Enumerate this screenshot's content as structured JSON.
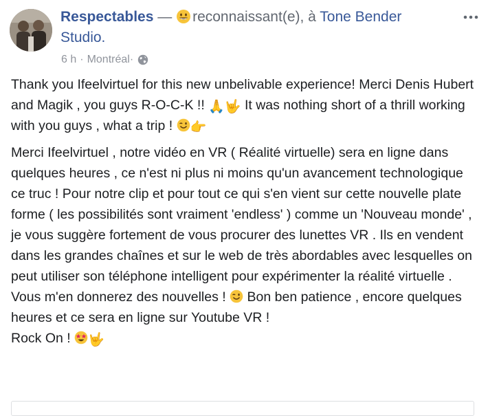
{
  "header": {
    "author": "Respectables",
    "dash": " — ",
    "feeling": "reconnaissant(e), à ",
    "place": "Tone Bender Studio.",
    "feeling_icon": "grinning-face-icon"
  },
  "meta": {
    "time": "6 h",
    "separator": "·",
    "location": "Montréal",
    "dot2": " · ",
    "audience_icon": "globe-icon"
  },
  "options_icon": "more-options-icon",
  "post": {
    "p1_text": "Thank you Ifeelvirtuel for this new unbelivable experience! Merci Denis Hubert and Magik , you guys R-O-C-K !! ",
    "p1_em1": "🙏",
    "p1_em2": "🤟",
    "p1_text2": " It was nothing short of a thrill working with you guys , what a trip ! ",
    "p1_em3_icon": "winking-face-icon",
    "p1_em4": "👉",
    "p2_text": "Merci Ifeelvirtuel , notre vidéo en VR ( Réalité virtuelle) sera en ligne dans quelques heures , ce n'est ni plus ni moins qu'un avancement technologique ce truc ! Pour notre clip et pour tout ce qui s'en vient sur cette nouvelle plate forme ( les possibilités sont vraiment 'endless' ) comme un 'Nouveau monde' , je vous suggère fortement de vous procurer des lunettes VR . Ils en vendent dans les grandes chaînes et sur le web de très abordables avec lesquelles on peut utiliser son téléphone intelligent pour expérimenter la réalité virtuelle . Vous m'en donnerez des nouvelles ! ",
    "p2_em1_icon": "winking-face-icon",
    "p2_text2": " Bon ben patience , encore quelques heures et ce sera en ligne sur Youtube VR !",
    "p3_text": "Rock On ! ",
    "p3_em1_icon": "star-struck-face-icon",
    "p3_em2": "🤟"
  },
  "colors": {
    "link": "#385898",
    "secondary": "#90949c",
    "text": "#1c1e21",
    "emoji_face": "#f7c43a"
  }
}
